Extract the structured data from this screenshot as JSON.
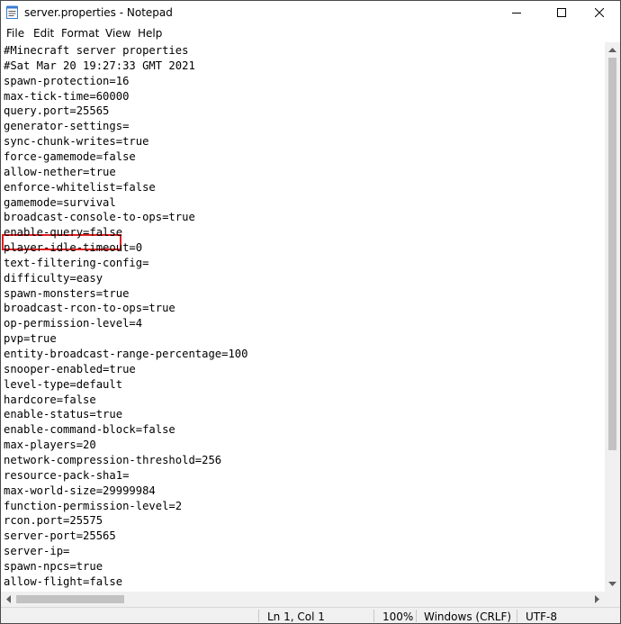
{
  "window": {
    "title": "server.properties - Notepad"
  },
  "titlebar_icons": {
    "app": "notepad-icon",
    "minimize": "minimize-icon",
    "maximize": "maximize-icon",
    "close": "close-icon"
  },
  "menu": [
    "File",
    "Edit",
    "Format",
    "View",
    "Help"
  ],
  "editor": {
    "lines": [
      "#Minecraft server properties",
      "#Sat Mar 20 19:27:33 GMT 2021",
      "spawn-protection=16",
      "max-tick-time=60000",
      "query.port=25565",
      "generator-settings=",
      "sync-chunk-writes=true",
      "force-gamemode=false",
      "allow-nether=true",
      "enforce-whitelist=false",
      "gamemode=survival",
      "broadcast-console-to-ops=true",
      "enable-query=false",
      "player-idle-timeout=0",
      "text-filtering-config=",
      "difficulty=easy",
      "spawn-monsters=true",
      "broadcast-rcon-to-ops=true",
      "op-permission-level=4",
      "pvp=true",
      "entity-broadcast-range-percentage=100",
      "snooper-enabled=true",
      "level-type=default",
      "hardcore=false",
      "enable-status=true",
      "enable-command-block=false",
      "max-players=20",
      "network-compression-threshold=256",
      "resource-pack-sha1=",
      "max-world-size=29999984",
      "function-permission-level=2",
      "rcon.port=25575",
      "server-port=25565",
      "server-ip=",
      "spawn-npcs=true",
      "allow-flight=false"
    ],
    "highlight_color": "#e01e1e"
  },
  "status": {
    "position": "Ln 1, Col 1",
    "zoom": "100%",
    "line_ending": "Windows (CRLF)",
    "encoding": "UTF-8"
  }
}
